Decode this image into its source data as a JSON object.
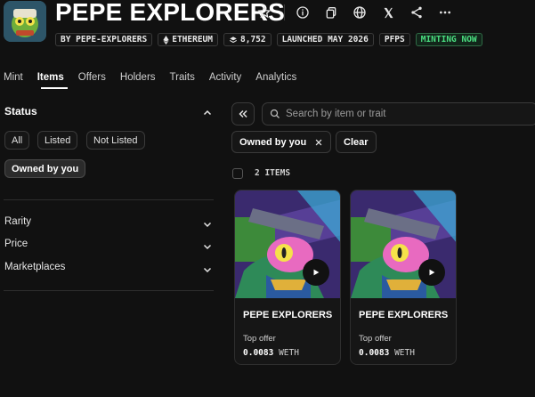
{
  "collection": {
    "title": "PEPE EXPLORERS",
    "chips": {
      "creator": "BY PEPE-EXPLORERS",
      "chain": "ETHEREUM",
      "supply": "8,752",
      "launched": "LAUNCHED MAY 2026",
      "type": "PFPS",
      "status": "MINTING NOW"
    },
    "status_color": "#4ade80"
  },
  "header_icons": [
    "star-icon",
    "info-icon",
    "copy-icon",
    "globe-icon",
    "x-icon",
    "share-icon",
    "more-icon"
  ],
  "tabs": [
    "Mint",
    "Items",
    "Offers",
    "Holders",
    "Traits",
    "Activity",
    "Analytics"
  ],
  "active_tab": "Items",
  "sidebar": {
    "status_title": "Status",
    "status_options": [
      "All",
      "Listed",
      "Not Listed",
      "Owned by you"
    ],
    "selected_status": "Owned by you",
    "sections": [
      "Rarity",
      "Price",
      "Marketplaces"
    ]
  },
  "search": {
    "placeholder": "Search by item or trait"
  },
  "active_filter": {
    "label": "Owned by you"
  },
  "clear_label": "Clear",
  "items_count": "2 ITEMS",
  "items": [
    {
      "name": "PEPE EXPLORERS",
      "offer_label": "Top offer",
      "offer_value": "0.0083",
      "offer_currency": "WETH"
    },
    {
      "name": "PEPE EXPLORERS",
      "offer_label": "Top offer",
      "offer_value": "0.0083",
      "offer_currency": "WETH"
    }
  ]
}
